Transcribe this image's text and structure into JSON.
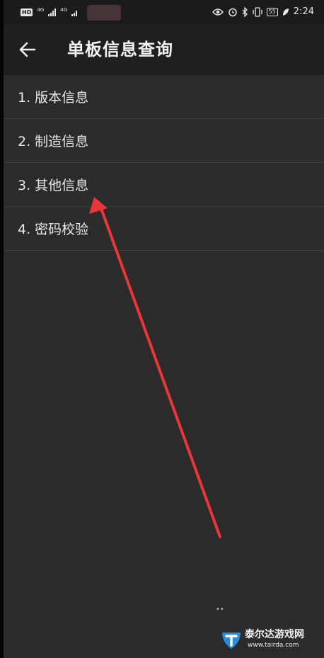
{
  "statusbar": {
    "left_badge": "HD",
    "network1": "4G",
    "network2": "4G",
    "battery": "55",
    "time": "2:24"
  },
  "appbar": {
    "title": "单板信息查询"
  },
  "menu": {
    "items": [
      {
        "label": "1. 版本信息"
      },
      {
        "label": "2. 制造信息"
      },
      {
        "label": "3. 其他信息"
      },
      {
        "label": "4. 密码校验"
      }
    ]
  },
  "annotation": {
    "arrow_color": "#e8363a"
  },
  "watermark": {
    "name": "泰尔达游戏网",
    "url": "www.tairda.com"
  }
}
